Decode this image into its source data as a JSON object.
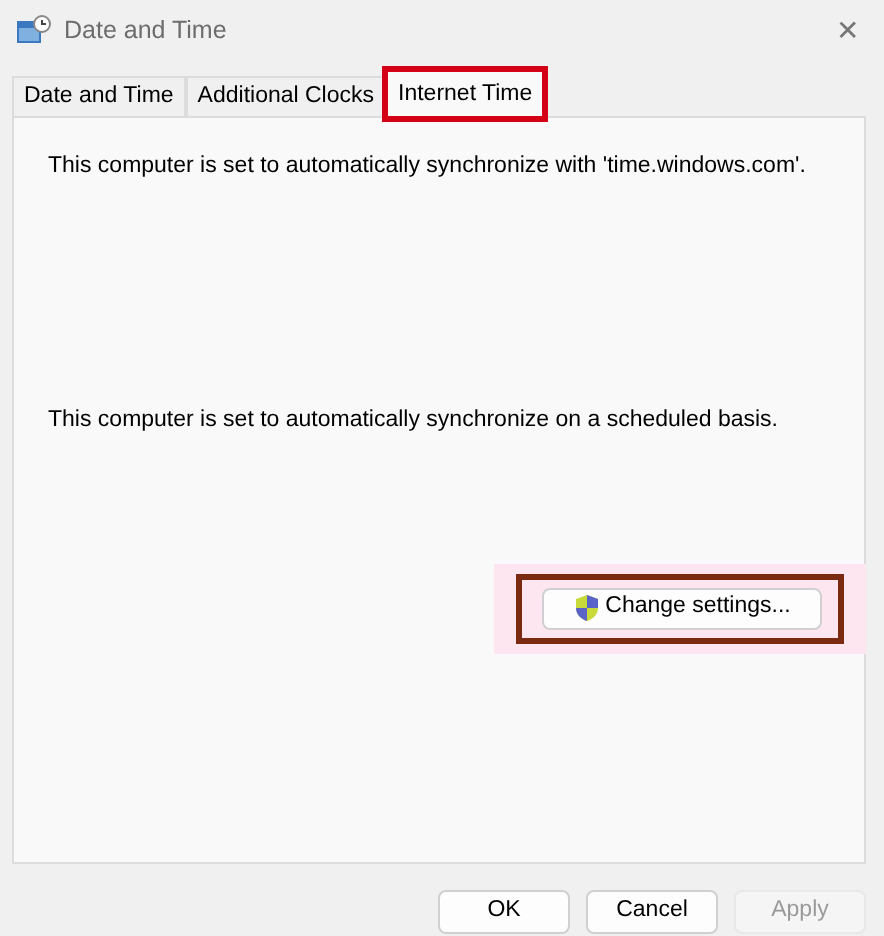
{
  "window": {
    "title": "Date and Time",
    "close": "✕"
  },
  "tabs": [
    {
      "label": "Date and Time",
      "selected": false,
      "highlighted": false
    },
    {
      "label": "Additional Clocks",
      "selected": false,
      "highlighted": false
    },
    {
      "label": "Internet Time",
      "selected": true,
      "highlighted": true
    }
  ],
  "panel": {
    "messages": [
      "This computer is set to automatically synchronize with 'time.windows.com'.",
      "This computer is set to automatically synchronize on a scheduled basis."
    ],
    "change_button": {
      "label": "Change settings...",
      "highlighted": true
    }
  },
  "buttons": [
    {
      "label": "OK",
      "disabled": false
    },
    {
      "label": "Cancel",
      "disabled": false
    },
    {
      "label": "Apply",
      "disabled": true
    }
  ]
}
